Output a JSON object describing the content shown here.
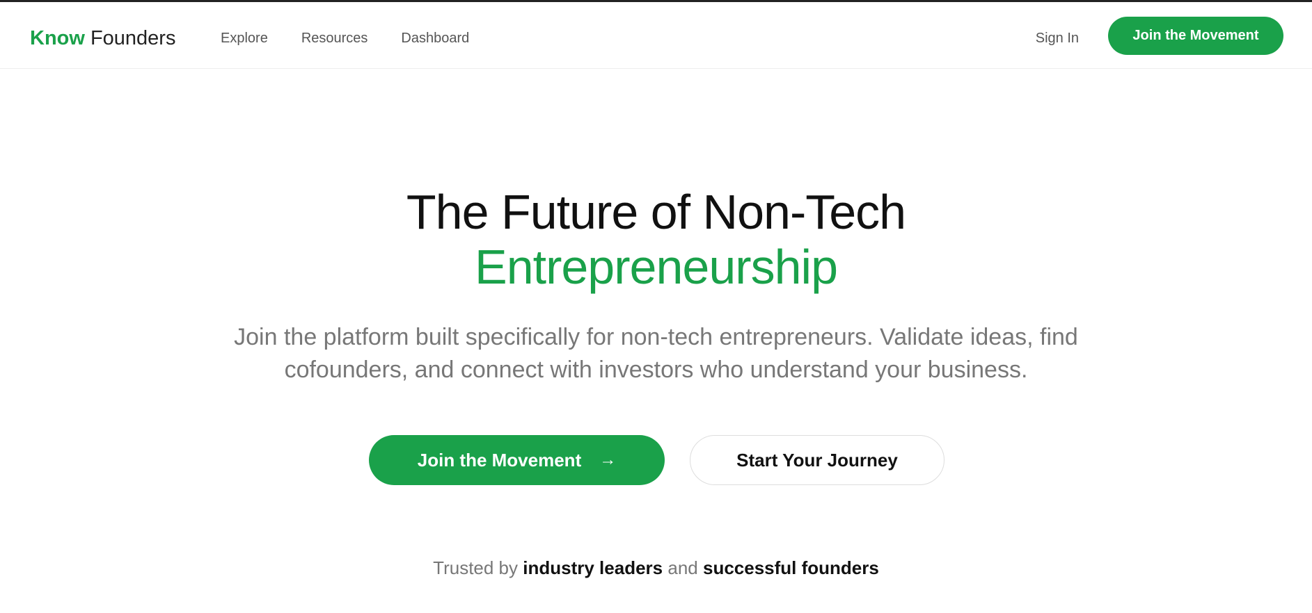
{
  "header": {
    "logo_primary": "Know",
    "logo_secondary": "Founders",
    "nav": [
      "Explore",
      "Resources",
      "Dashboard"
    ],
    "sign_in": "Sign In",
    "cta": "Join the Movement"
  },
  "hero": {
    "title_line1": "The Future of Non-Tech",
    "title_line2": "Entrepreneurship",
    "subtitle": "Join the platform built specifically for non-tech entrepreneurs. Validate ideas, find cofounders, and connect with investors who understand your business.",
    "primary_cta": "Join the Movement",
    "primary_cta_icon": "arrow-right-icon",
    "secondary_cta": "Start Your Journey"
  },
  "trusted": {
    "prefix": "Trusted by",
    "highlight1": "industry leaders",
    "connector": "and",
    "highlight2": "successful founders"
  },
  "colors": {
    "brand_green": "#1aa14a",
    "text_dark": "#111111",
    "text_muted": "#777777"
  }
}
